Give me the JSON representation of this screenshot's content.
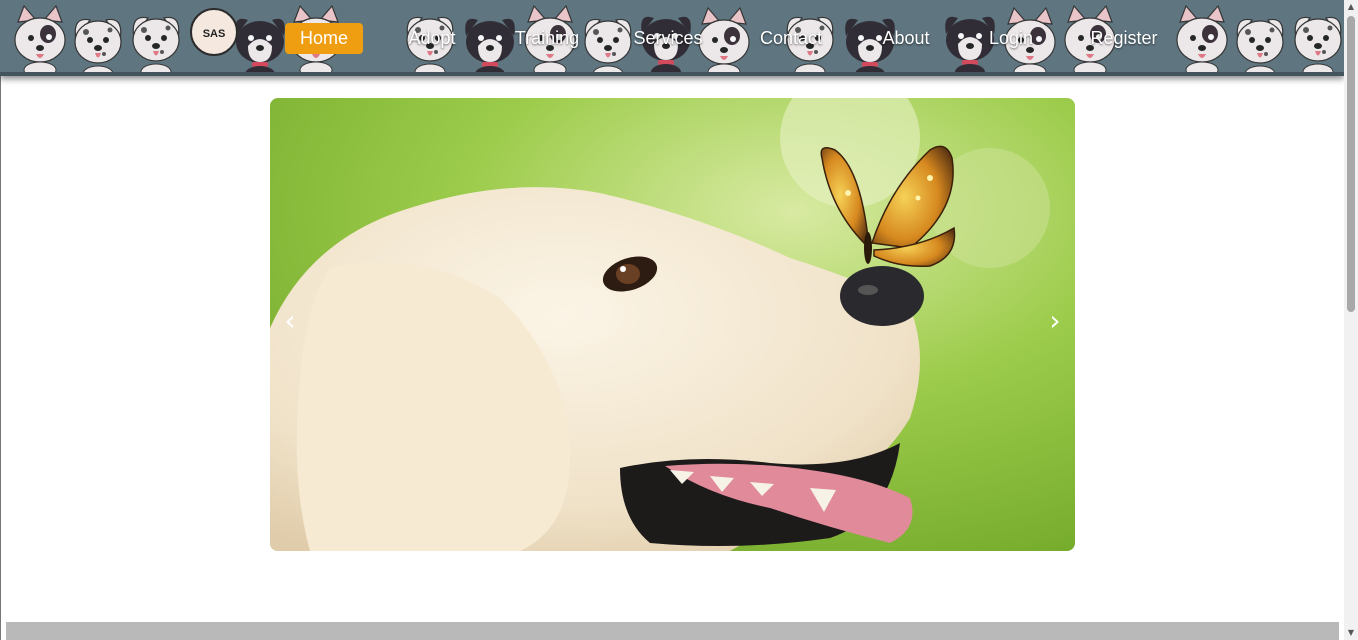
{
  "brand": {
    "logo_text": "SAS"
  },
  "nav": {
    "items": [
      {
        "label": "Home",
        "active": true
      },
      {
        "label": "Adopt",
        "active": false
      },
      {
        "label": "Training",
        "active": false
      },
      {
        "label": "Services",
        "active": false
      },
      {
        "label": "Contact",
        "active": false
      },
      {
        "label": "About",
        "active": false
      },
      {
        "label": "Login",
        "active": false
      },
      {
        "label": "Register",
        "active": false
      }
    ]
  },
  "carousel": {
    "prev_glyph": "‹",
    "next_glyph": "›"
  },
  "colors": {
    "accent": "#ee9e10",
    "navbar_bg": "#5f7580",
    "footer_strip": "#b9b9b9"
  },
  "icons": {
    "logo": "sas-logo-icon",
    "prev": "chevron-left-icon",
    "next": "chevron-right-icon"
  }
}
